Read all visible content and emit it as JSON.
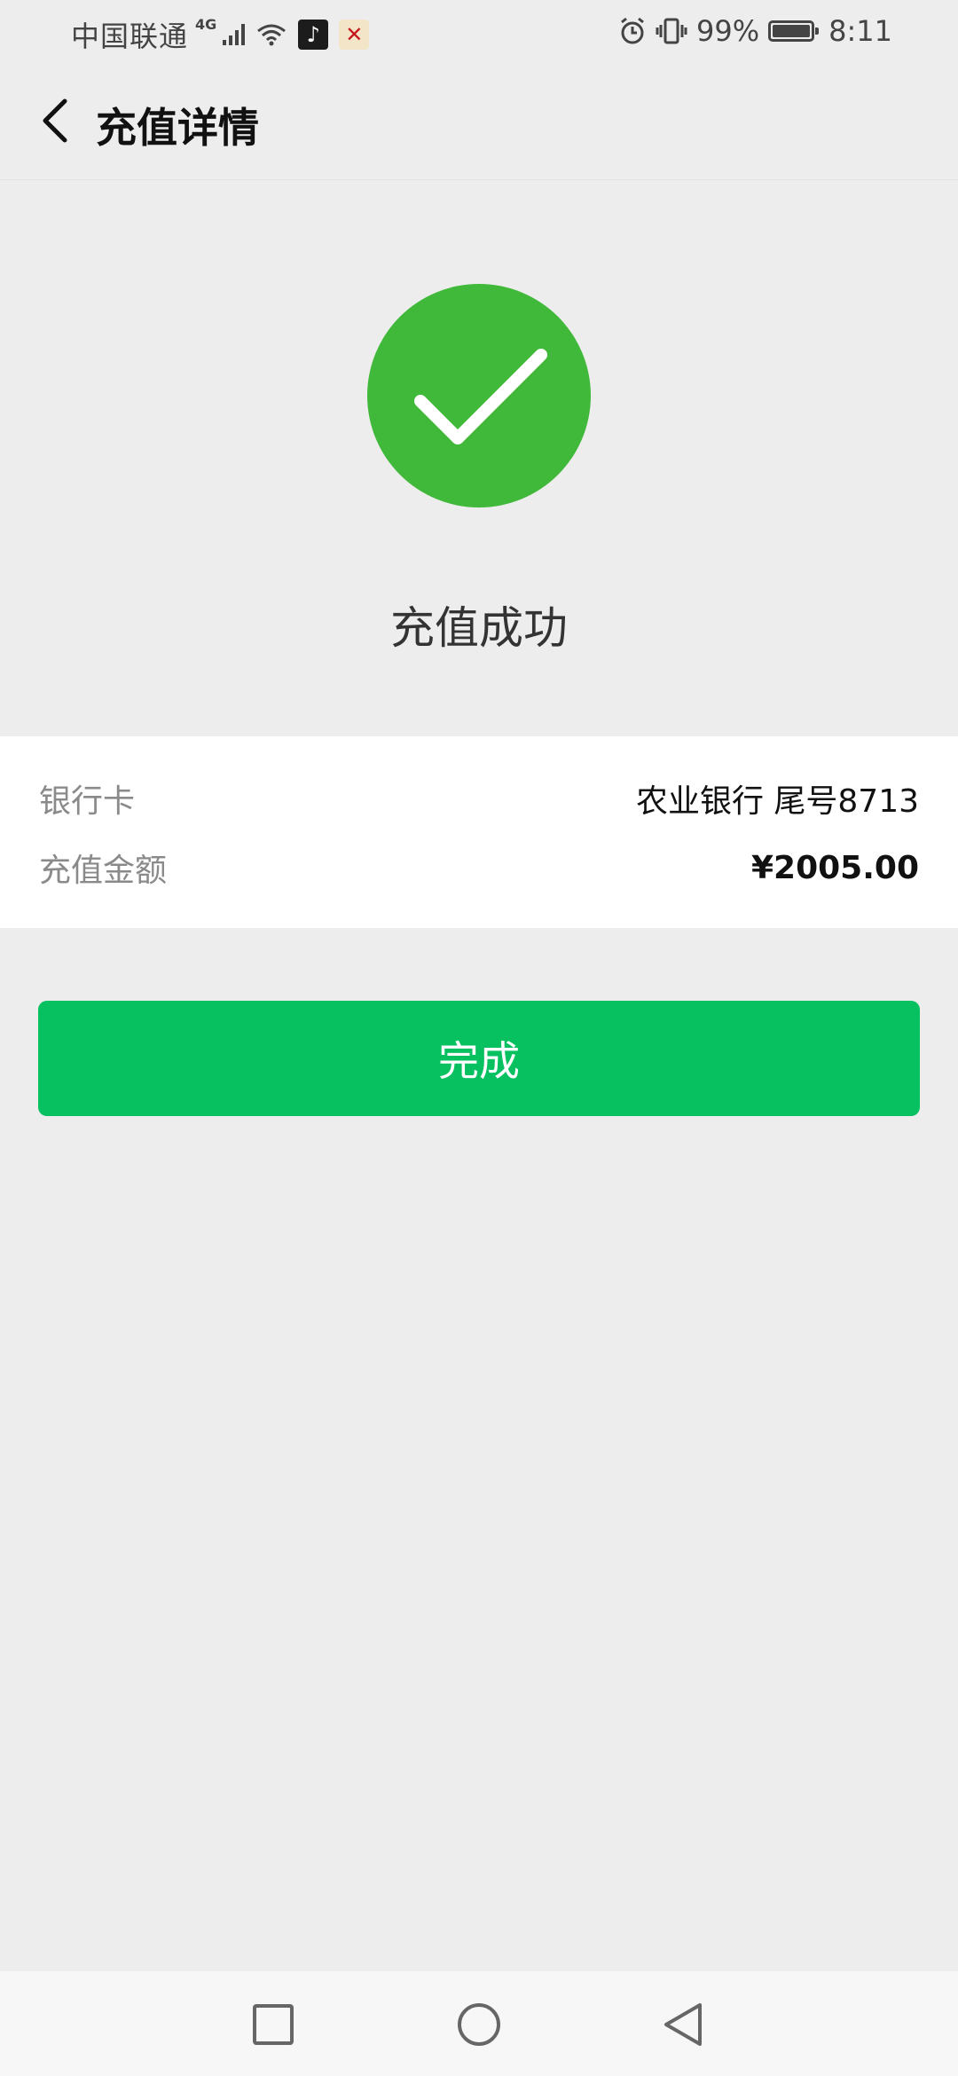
{
  "status_bar": {
    "carrier": "中国联通",
    "network": "4G",
    "battery": "99%",
    "battery_level": 0.99,
    "time": "8:11"
  },
  "header": {
    "title": "充值详情"
  },
  "result": {
    "status_text": "充值成功",
    "icon_color": "#40b93a"
  },
  "details": {
    "bank_label": "银行卡",
    "bank_value": "农业银行 尾号8713",
    "amount_label": "充值金额",
    "amount_value": "¥2005.00"
  },
  "actions": {
    "done_label": "完成",
    "button_color": "#07c160"
  },
  "icons": {
    "back": "chevron-left-icon",
    "success": "check-circle-icon",
    "signal": "signal-icon",
    "wifi": "wifi-icon",
    "alarm": "alarm-icon",
    "vibrate": "vibrate-icon",
    "battery": "battery-icon",
    "recent": "square-icon",
    "home": "circle-icon",
    "sys_back": "triangle-back-icon"
  }
}
